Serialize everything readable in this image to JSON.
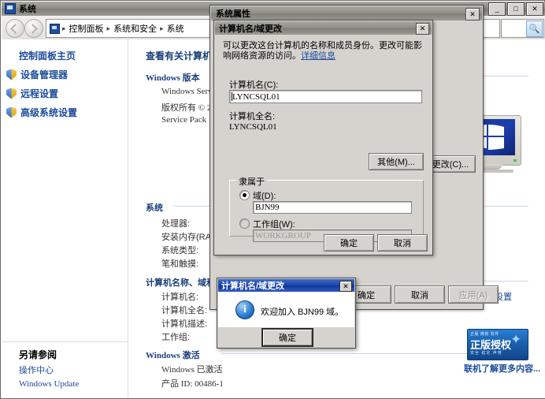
{
  "system_window": {
    "title": "系统",
    "title_icon": "system-icon",
    "window_buttons": [
      "_",
      "□",
      "✕"
    ],
    "breadcrumb": {
      "icon": "control-panel-icon",
      "items": [
        "控制面板",
        "系统和安全",
        "系统"
      ],
      "separator": "▸"
    },
    "search": {
      "value": "",
      "placeholder": "",
      "icon": "search-icon"
    },
    "help_icon": "help-icon",
    "sidebar": {
      "home": "控制面板主页",
      "items": [
        {
          "label": "设备管理器",
          "icon": "shield-icon"
        },
        {
          "label": "远程设置",
          "icon": "shield-icon"
        },
        {
          "label": "高级系统设置",
          "icon": "shield-icon"
        }
      ],
      "see_also_title": "另请参阅",
      "see_also_links": [
        "操作中心",
        "Windows Update"
      ]
    },
    "main": {
      "heading": "查看有关计算机的基本信息",
      "windows_edition": {
        "group_title": "Windows 版本",
        "lines": [
          "Windows Server 2008 R2 Enterprise",
          "版权所有 © 2009 Microsoft Corporation。保留所有权利。",
          "Service Pack 1"
        ]
      },
      "system": {
        "group_title": "系统",
        "rows": [
          {
            "label": "处理器:",
            "value": ""
          },
          {
            "label": "安装内存(RAM):",
            "value": ""
          },
          {
            "label": "系统类型:",
            "value": ""
          },
          {
            "label": "笔和触摸:",
            "value": ""
          }
        ]
      },
      "computer_name_group": {
        "group_title": "计算机名称、域和工作组设置",
        "rows": [
          {
            "label": "计算机名:",
            "value": ""
          },
          {
            "label": "计算机全名:",
            "value": ""
          },
          {
            "label": "计算机描述:",
            "value": ""
          },
          {
            "label": "工作组:",
            "value": ""
          }
        ],
        "change_settings_link": "更改设置"
      },
      "activation": {
        "group_title": "Windows 激活",
        "status": "Windows 已激活",
        "product_id": "产品 ID: 00486-1"
      },
      "genuine": {
        "top_text": "正版 微软 软件",
        "main_text": "正版授权",
        "sub_text": "安全 稳定 声誉",
        "star_icon": "star-icon",
        "link": "联机了解更多内容..."
      }
    }
  },
  "system_properties": {
    "title": "系统属性",
    "close_icon": "close-icon",
    "buttons": [
      {
        "label": "确定",
        "enabled": true
      },
      {
        "label": "取消",
        "enabled": true
      },
      {
        "label": "应用(A)",
        "enabled": false
      }
    ],
    "more_button": "更改(C)..."
  },
  "computer_name_dialog": {
    "title": "计算机名/域更改",
    "close_icon": "close-icon",
    "description": "可以更改这台计算机的名称和成员身份。更改可能影响网络资源的访问。",
    "description_link": "详细信息",
    "computer_name_label": "计算机名(C):",
    "computer_name_value": "LYNCSQL01",
    "full_name_label": "计算机全名:",
    "full_name_value": "LYNCSQL01",
    "more_button": "其他(M)...",
    "member_of_label": "隶属于",
    "domain_radio_label": "域(D):",
    "domain_value": "BJN99",
    "domain_selected": true,
    "workgroup_radio_label": "工作组(W):",
    "workgroup_value": "WORKGROUP",
    "workgroup_selected": false,
    "ok_button": "确定",
    "cancel_button": "取消"
  },
  "message_box": {
    "title": "计算机名/域更改",
    "close_icon": "close-icon",
    "icon": "info-icon",
    "message": "欢迎加入 BJN99 域。",
    "ok_button": "确定"
  }
}
